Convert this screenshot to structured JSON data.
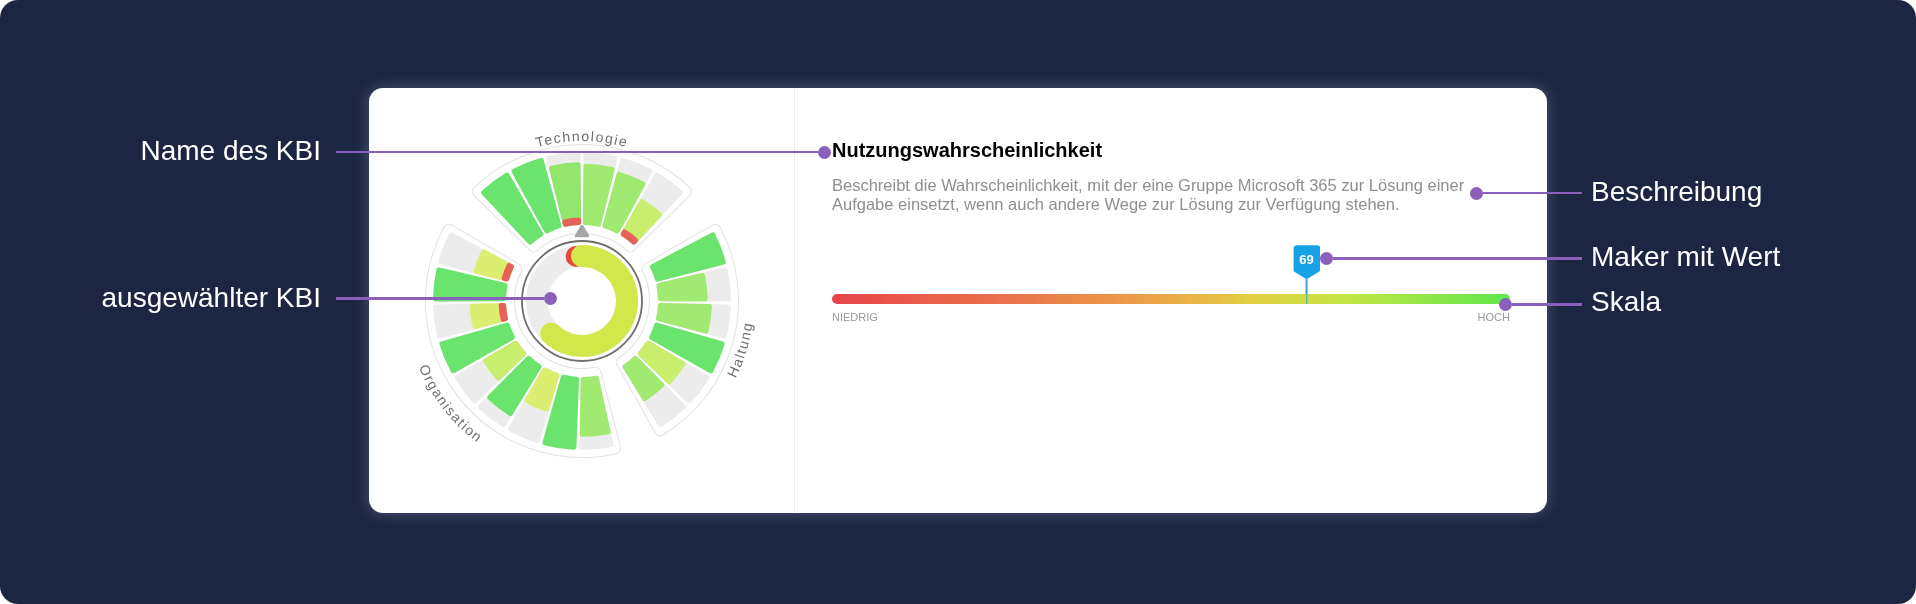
{
  "left_callouts": [
    {
      "label": "Name des KBI"
    },
    {
      "label": "ausgewählter KBI"
    }
  ],
  "card": {
    "wheel": {
      "category_labels": [
        {
          "label": "Technologie"
        },
        {
          "label": "Haltung"
        },
        {
          "label": "Organisation"
        }
      ]
    },
    "kbi": {
      "title": "Nutzungswahrscheinlichkeit",
      "description": "Beschreibt die Wahrscheinlichkeit, mit der eine Gruppe Microsoft 365 zur Lösung einer Aufgabe einsetzt, wenn auch andere Wege zur Lösung zur Verfügung stehen.",
      "scale": {
        "level": 0.7,
        "marker_value": "69",
        "low_label": "NIEDRIG",
        "high_label": "HOCH"
      }
    }
  },
  "right_callouts": [
    {
      "label": "Beschreibung"
    },
    {
      "label": "Maker mit Wert"
    },
    {
      "label": "Skala"
    }
  ]
}
